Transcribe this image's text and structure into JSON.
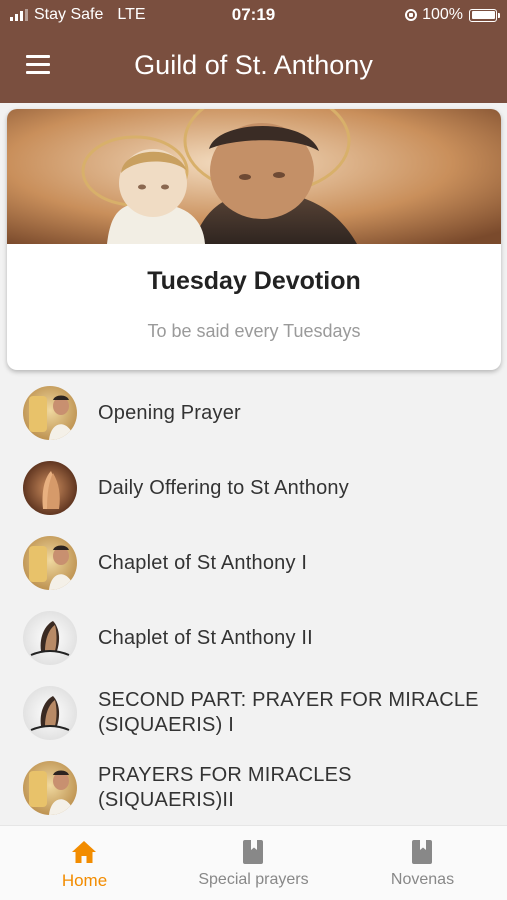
{
  "status_bar": {
    "carrier": "Stay Safe",
    "network": "LTE",
    "time": "07:19",
    "battery": "100%",
    "battery_level": 1.0
  },
  "header": {
    "title": "Guild of St. Anthony",
    "menu_icon": "hamburger-menu-icon"
  },
  "hero": {
    "title": "Tuesday Devotion",
    "subtitle": "To be said every Tuesdays"
  },
  "prayers": [
    {
      "label": "Opening Prayer",
      "avatar": "statue-image"
    },
    {
      "label": "Daily Offering to St Anthony",
      "avatar": "praying-hands-image"
    },
    {
      "label": "Chaplet of St Anthony I",
      "avatar": "statue-image"
    },
    {
      "label": "Chaplet of St Anthony II",
      "avatar": "devotion-image"
    },
    {
      "label": "SECOND PART: PRAYER FOR MIRACLE (SIQUAERIS) I",
      "avatar": "devotion-image"
    },
    {
      "label": "PRAYERS FOR MIRACLES (SIQUAERIS)II",
      "avatar": "statue-image"
    }
  ],
  "bottom_nav": {
    "items": [
      {
        "label": "Home",
        "icon": "home-icon",
        "active": true
      },
      {
        "label": "Special prayers",
        "icon": "book-icon",
        "active": false
      },
      {
        "label": "Novenas",
        "icon": "book-icon",
        "active": false
      }
    ]
  },
  "colors": {
    "header_bg": "#7a4f3f",
    "accent": "#f28c00",
    "page_bg": "#f2f2f2"
  }
}
